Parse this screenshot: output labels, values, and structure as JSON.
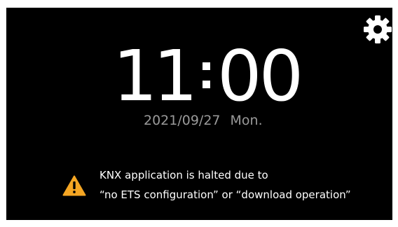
{
  "settings": {
    "icon": "gear-icon"
  },
  "clock": {
    "hours": "11",
    "minutes": "00"
  },
  "date": {
    "date": "2021/09/27",
    "weekday": "Mon."
  },
  "alert": {
    "icon": "warning-icon",
    "line1": "KNX application is halted due to",
    "line2": "“no ETS configuration”  or  “download operation”"
  },
  "colors": {
    "background": "#000000",
    "text": "#ffffff",
    "date": "#9a9a9a",
    "warning": "#f5a623"
  }
}
